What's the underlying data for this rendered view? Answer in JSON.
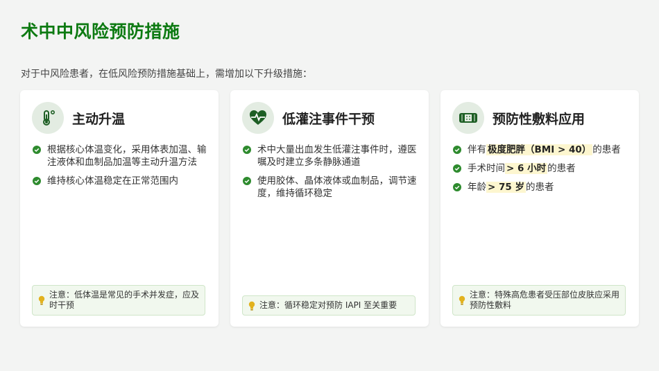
{
  "page": {
    "title": "术中中风险预防措施",
    "intro": "对于中风险患者，在低风险预防措施基础上，需增加以下升级措施："
  },
  "colors": {
    "accent": "#0d7a12",
    "check": "#2e8b2e",
    "highlight_bg": "#fdf6cf",
    "note_bg": "#f1f8ee"
  },
  "cards": [
    {
      "icon": "thermometer-icon",
      "title": "主动升温",
      "bullets": [
        "根据核心体温变化，采用体表加温、输注液体和血制品加温等主动升温方法",
        "维持核心体温稳定在正常范围内"
      ],
      "note": "注意：低体温是常见的手术并发症，应及时干预"
    },
    {
      "icon": "heart-pulse-icon",
      "title": "低灌注事件干预",
      "bullets": [
        "术中大量出血发生低灌注事件时，遵医嘱及时建立多条静脉通道",
        "使用胶体、晶体液体或血制品，调节速度，维持循环稳定"
      ],
      "note": "注意：循环稳定对预防 IAPI 至关重要"
    },
    {
      "icon": "bandage-icon",
      "title": "预防性敷料应用",
      "bullets": [
        {
          "pre": "伴有",
          "hl": "极度肥胖（BMI > 40）",
          "post": "的患者"
        },
        {
          "pre": "手术时间",
          "hl": "> 6 小时",
          "post": "的患者"
        },
        {
          "pre": "年龄",
          "hl": "> 75 岁",
          "post": "的患者"
        }
      ],
      "note": "注意：特殊高危患者受压部位皮肤应采用预防性敷料"
    }
  ]
}
